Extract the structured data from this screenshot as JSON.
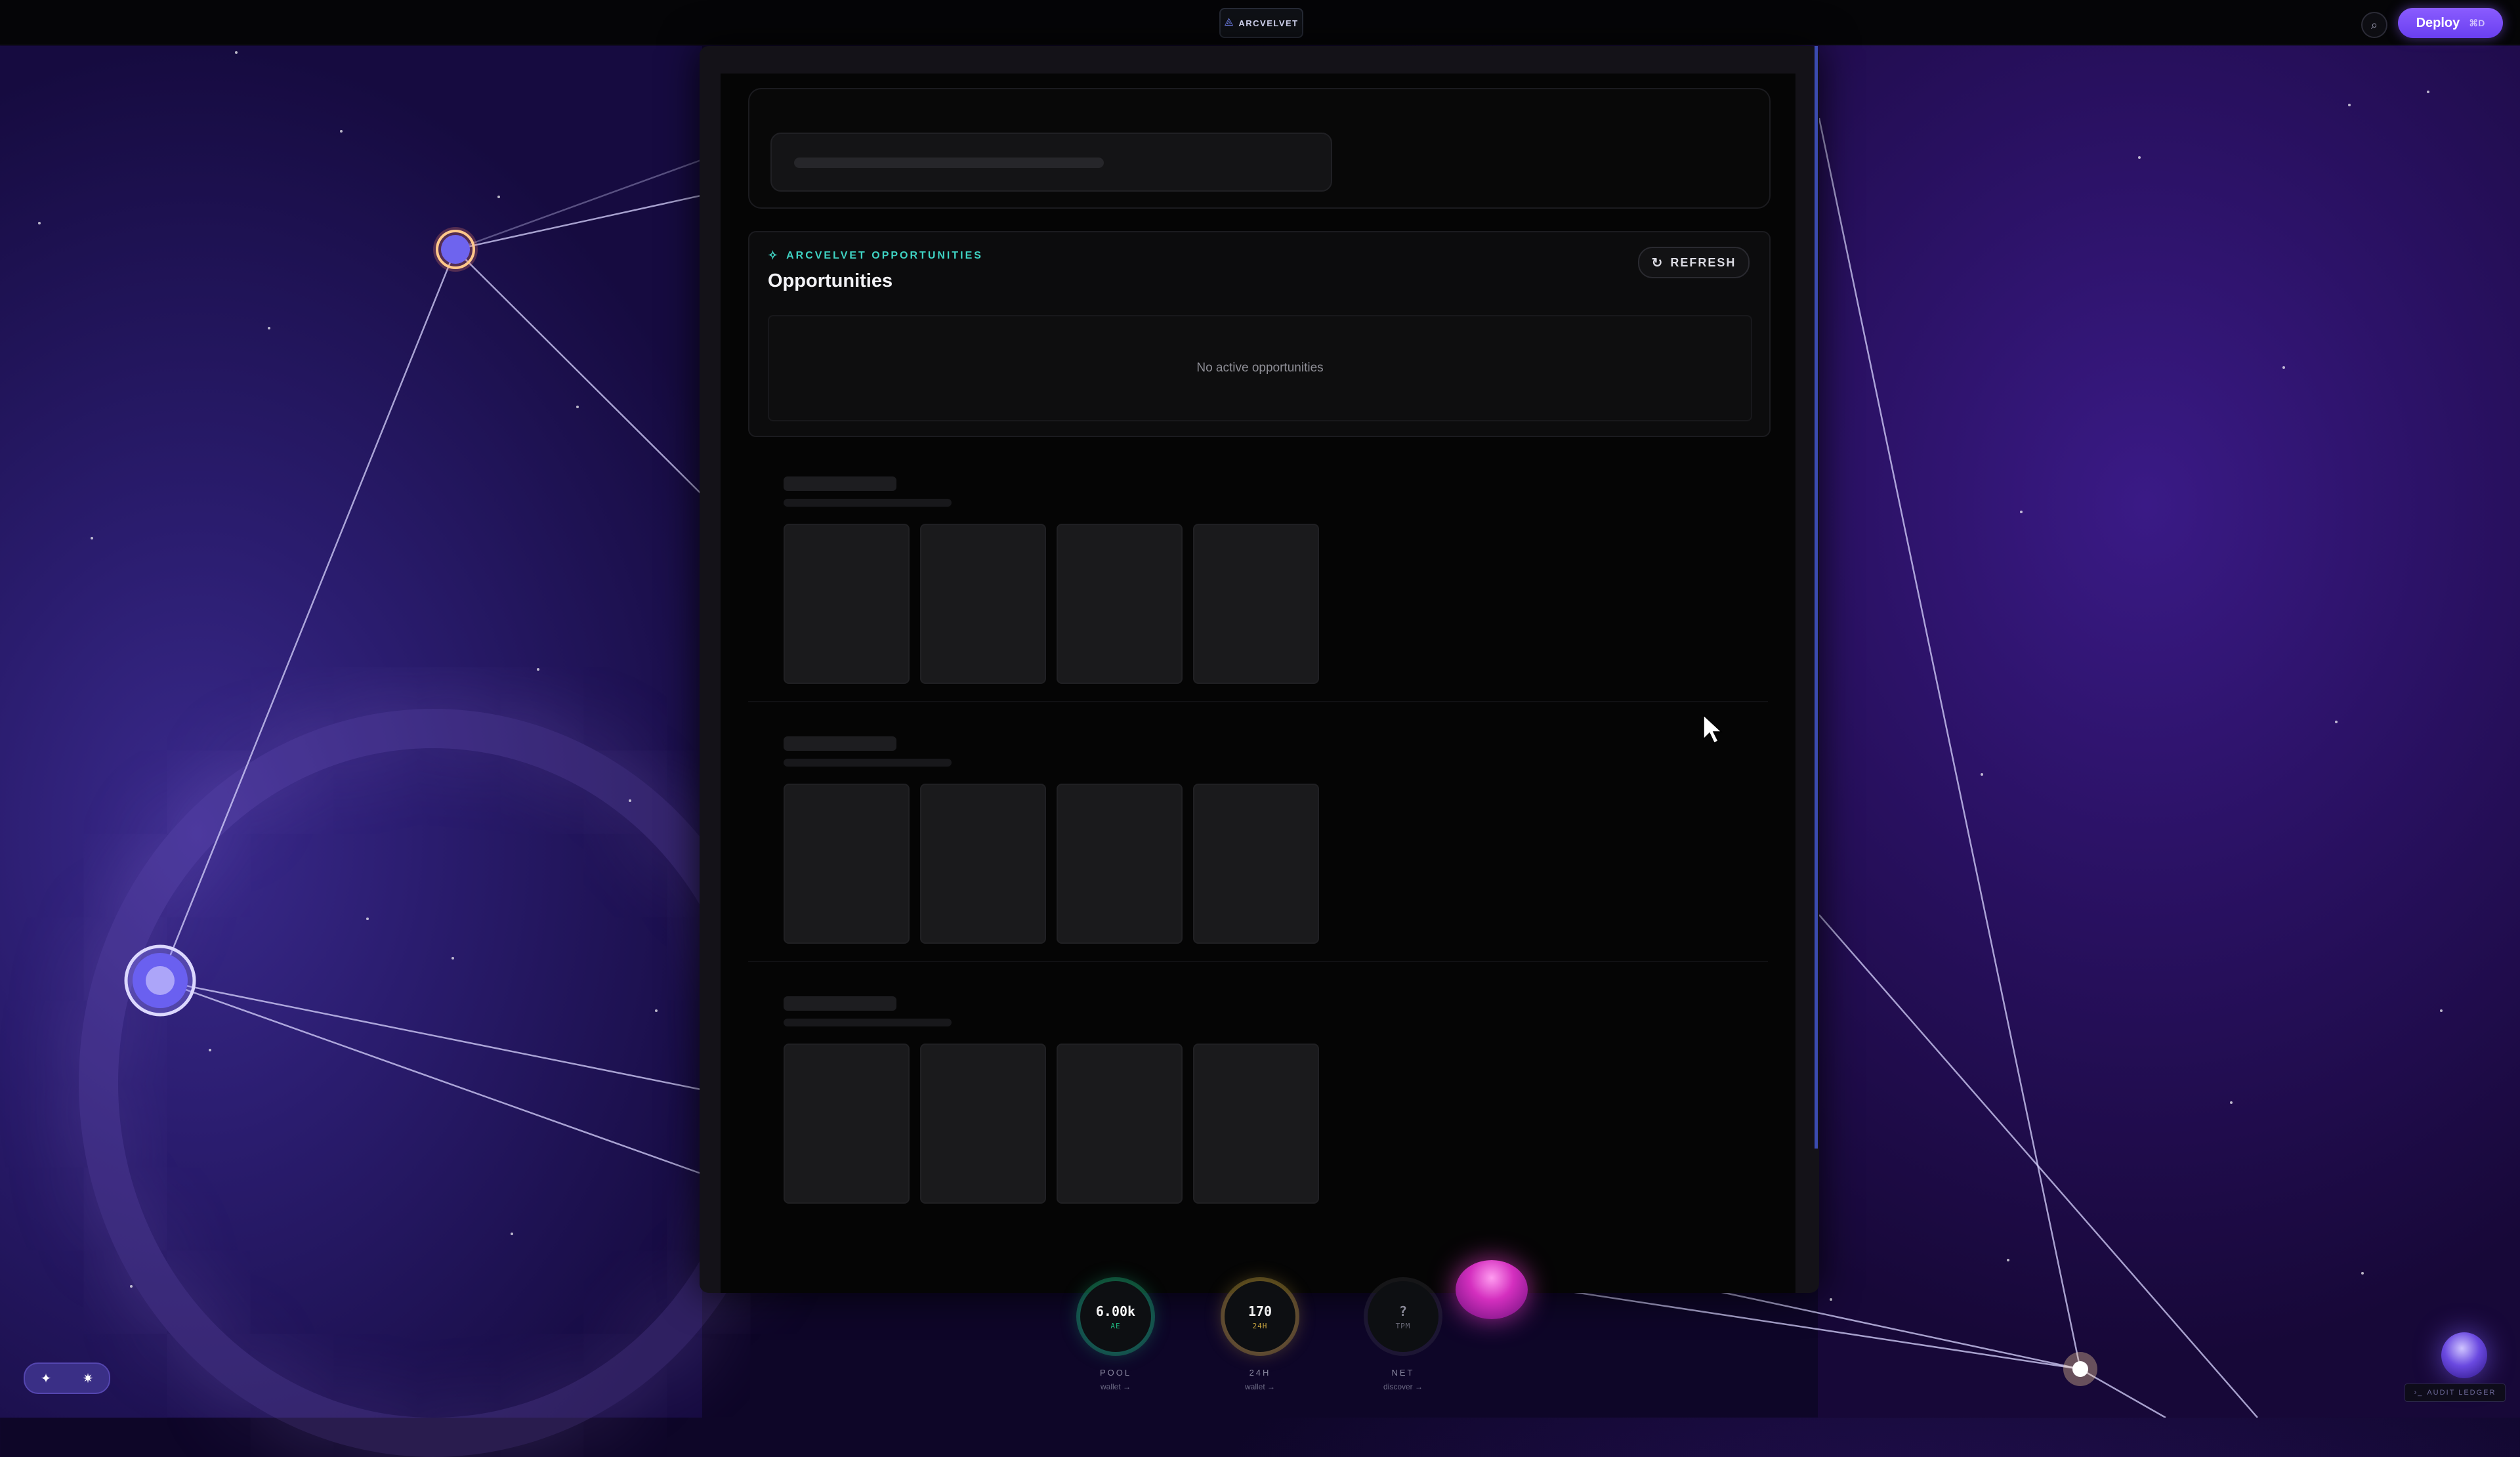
{
  "header": {
    "logo_text": "ARCVELVET",
    "search_icon": "search-icon",
    "deploy_label": "Deploy",
    "deploy_shortcut": "⌘D"
  },
  "search": {
    "placeholder": ""
  },
  "opportunities": {
    "kicker": "ARCVELVET OPPORTUNITIES",
    "title": "Opportunities",
    "refresh_label": "REFRESH",
    "empty_message": "No active opportunities"
  },
  "gauges": [
    {
      "value": "6.00k",
      "unit": "AE",
      "label": "POOL",
      "link": "wallet →",
      "color": "#1fb980"
    },
    {
      "value": "170",
      "unit": "24H",
      "label": "24H",
      "link": "wallet →",
      "color": "#c9a640"
    },
    {
      "value": "?",
      "unit": "TPM",
      "label": "NET",
      "link": "discover →",
      "color": "#5a5a66"
    }
  ],
  "theme_toggle": {
    "left_icon": "✦",
    "right_icon": "✷"
  },
  "audit": {
    "label": "AUDIT LEDGER"
  }
}
